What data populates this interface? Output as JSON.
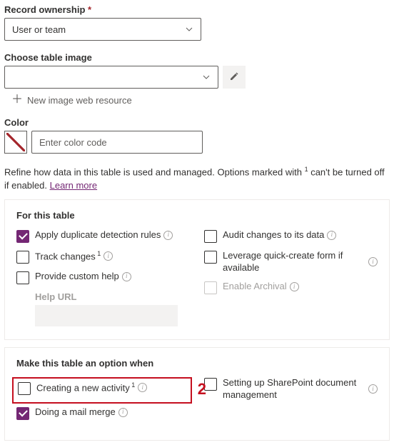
{
  "recordOwnership": {
    "label": "Record ownership",
    "required": "*",
    "value": "User or team"
  },
  "tableImage": {
    "label": "Choose table image",
    "value": "",
    "newLink": "New image web resource"
  },
  "color": {
    "label": "Color",
    "placeholder": "Enter color code",
    "value": ""
  },
  "description": {
    "text_a": "Refine how data in this table is used and managed. Options marked with ",
    "sup": "1",
    "text_b": " can't be turned off if enabled. ",
    "learn": "Learn more"
  },
  "panel1": {
    "title": "For this table",
    "left": {
      "applyDup": "Apply duplicate detection rules",
      "trackChanges": "Track changes",
      "trackChangesSup": "1",
      "provideHelp": "Provide custom help",
      "helpUrlLabel": "Help URL"
    },
    "right": {
      "audit": "Audit changes to its data",
      "leverage": "Leverage quick-create form if available",
      "archival": "Enable Archival"
    }
  },
  "panel2": {
    "title": "Make this table an option when",
    "annotation": "2",
    "left": {
      "newActivity": "Creating a new activity",
      "newActivitySup": "1",
      "mailMerge": "Doing a mail merge"
    },
    "right": {
      "sharepoint": "Setting up SharePoint document management"
    }
  }
}
